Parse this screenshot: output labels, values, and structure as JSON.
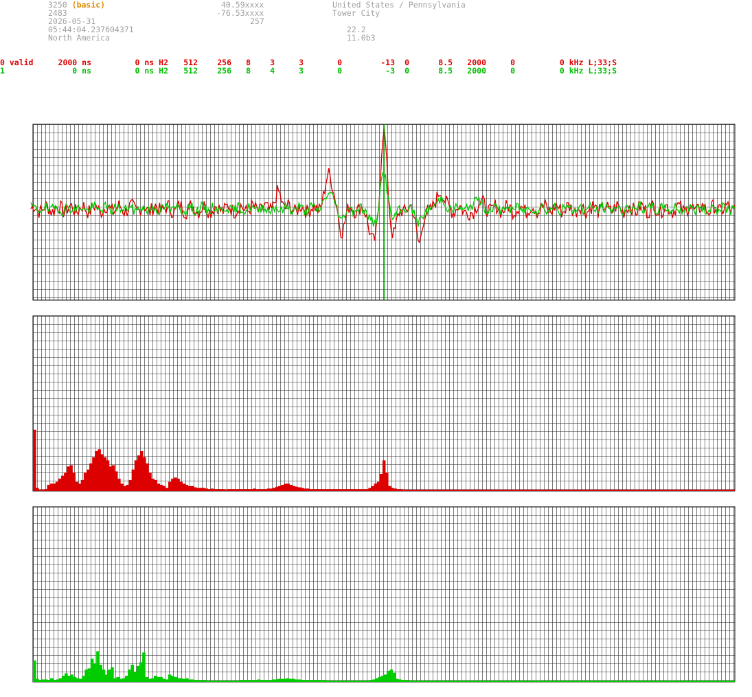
{
  "header": {
    "id": "3250",
    "mode": "(basic)",
    "lat": "40.59xxxx",
    "location": "United States / Pennsylvania",
    "num": "2483",
    "lon": "-76.53xxxx",
    "city": "Tower City",
    "date": "2026-05-31",
    "alt": "257",
    "time": "05:44:04.237604371",
    "v1": "22.2",
    "region": "North America",
    "v2": "11.0b3"
  },
  "rows": [
    {
      "cells": [
        "0 valid",
        "2000 ns",
        "0 ns H2",
        "512",
        "256",
        "8",
        "3",
        "3",
        "0",
        "-13",
        "0",
        "8.5",
        "2000",
        "0",
        "0 kHz L;33;S"
      ]
    },
    {
      "cells": [
        "1",
        "0 ns",
        "0 ns H2",
        "512",
        "256",
        "8",
        "4",
        "3",
        "0",
        "-3",
        "0",
        "8.5",
        "2000",
        "0",
        "0 kHz L;33;S"
      ]
    }
  ],
  "colors": {
    "series_a": "#dd0000",
    "series_b": "#00cc00",
    "grid": "#000000",
    "marker": "#00aa00"
  },
  "chart_data": [
    {
      "type": "line",
      "title": "",
      "grid": true,
      "ylim": [
        -1,
        1
      ],
      "marker_x": 0.5,
      "series": [
        {
          "color": "#dd0000",
          "base_seed": 7,
          "noise": 0.09,
          "features": [
            [
              0.424,
              0.42,
              0.008
            ],
            [
              0.441,
              -0.26,
              0.006
            ],
            [
              0.487,
              -0.42,
              0.008
            ],
            [
              0.501,
              0.95,
              0.006
            ],
            [
              0.515,
              -0.28,
              0.007
            ],
            [
              0.552,
              -0.4,
              0.006
            ],
            [
              0.582,
              0.24,
              0.006
            ],
            [
              0.63,
              -0.18,
              0.008
            ],
            [
              0.634,
              0.22,
              0.007
            ],
            [
              0.352,
              0.18,
              0.006
            ]
          ]
        },
        {
          "color": "#00cc00",
          "base_seed": 19,
          "noise": 0.06,
          "features": [
            [
              0.424,
              0.2,
              0.008
            ],
            [
              0.441,
              -0.12,
              0.006
            ],
            [
              0.487,
              -0.2,
              0.008
            ],
            [
              0.501,
              0.42,
              0.007
            ],
            [
              0.515,
              -0.12,
              0.007
            ],
            [
              0.552,
              -0.18,
              0.006
            ],
            [
              0.582,
              0.14,
              0.006
            ],
            [
              0.634,
              0.12,
              0.007
            ]
          ]
        }
      ]
    },
    {
      "type": "bar",
      "color": "#dd0000",
      "ylim": [
        0,
        100
      ],
      "values": [
        100,
        5,
        2,
        2,
        3,
        10,
        12,
        12,
        15,
        20,
        25,
        30,
        40,
        42,
        30,
        15,
        12,
        18,
        30,
        35,
        45,
        55,
        65,
        68,
        60,
        55,
        50,
        40,
        42,
        32,
        20,
        12,
        8,
        10,
        18,
        35,
        50,
        58,
        65,
        55,
        45,
        30,
        20,
        18,
        12,
        10,
        8,
        5,
        15,
        20,
        22,
        20,
        15,
        12,
        10,
        8,
        8,
        6,
        5,
        5,
        5,
        4,
        3,
        4,
        3,
        3,
        3,
        3,
        2,
        3,
        3,
        3,
        3,
        3,
        3,
        3,
        3,
        3,
        4,
        3,
        3,
        3,
        3,
        4,
        4,
        5,
        7,
        8,
        10,
        12,
        12,
        10,
        8,
        7,
        6,
        5,
        4,
        4,
        3,
        3,
        3,
        3,
        3,
        3,
        3,
        3,
        3,
        3,
        3,
        3,
        3,
        3,
        3,
        3,
        3,
        3,
        3,
        3,
        3,
        5,
        8,
        12,
        15,
        28,
        50,
        30,
        8,
        5,
        4,
        3,
        3,
        2,
        2,
        2,
        2,
        2,
        2,
        2,
        2,
        2,
        2,
        2,
        2,
        2,
        2,
        2,
        2,
        2,
        2,
        2,
        2,
        2,
        2,
        2,
        2,
        2,
        2,
        2,
        2,
        2,
        2,
        2,
        2,
        2,
        2,
        2,
        2,
        2,
        2,
        2,
        2,
        2,
        2,
        2,
        2,
        2,
        2,
        2,
        2,
        2,
        2,
        2,
        2,
        2,
        2,
        2,
        2,
        2,
        2,
        2,
        2,
        2,
        2,
        2,
        2,
        2,
        2,
        2,
        2,
        2,
        2,
        2,
        2,
        2,
        2,
        2,
        2,
        2,
        2,
        2,
        2,
        2,
        2,
        2,
        2,
        2,
        2,
        2,
        2,
        2,
        2,
        2,
        2,
        2,
        2,
        2,
        2,
        2,
        2,
        2,
        2,
        2,
        2,
        2,
        2,
        2,
        2,
        2,
        2,
        2,
        2,
        2,
        2,
        2,
        2,
        2,
        2,
        2,
        2
      ]
    },
    {
      "type": "bar",
      "color": "#00cc00",
      "ylim": [
        0,
        100
      ],
      "values": [
        35,
        5,
        3,
        4,
        4,
        3,
        6,
        3,
        4,
        6,
        10,
        14,
        10,
        12,
        8,
        6,
        5,
        10,
        20,
        22,
        38,
        30,
        50,
        28,
        20,
        12,
        20,
        24,
        6,
        8,
        5,
        6,
        10,
        20,
        28,
        16,
        26,
        32,
        48,
        8,
        5,
        6,
        10,
        8,
        8,
        5,
        4,
        12,
        10,
        8,
        6,
        6,
        5,
        6,
        4,
        4,
        3,
        3,
        3,
        3,
        2,
        2,
        2,
        2,
        2,
        2,
        2,
        2,
        2,
        2,
        2,
        2,
        3,
        3,
        3,
        3,
        3,
        3,
        4,
        3,
        3,
        3,
        3,
        4,
        4,
        5,
        5,
        5,
        6,
        5,
        5,
        4,
        4,
        3,
        3,
        3,
        3,
        3,
        3,
        3,
        3,
        3,
        2,
        2,
        2,
        2,
        2,
        2,
        2,
        2,
        2,
        2,
        2,
        2,
        2,
        2,
        2,
        3,
        4,
        6,
        8,
        10,
        12,
        18,
        20,
        15,
        5,
        4,
        3,
        3,
        3,
        2,
        2,
        2,
        2,
        2,
        2,
        2,
        2,
        2,
        2,
        2,
        2,
        2,
        2,
        2,
        2,
        2,
        2,
        2,
        2,
        2,
        2,
        2,
        2,
        2,
        2,
        2,
        2,
        2,
        2,
        2,
        2,
        2,
        2,
        2,
        2,
        2,
        2,
        2,
        2,
        2,
        2,
        2,
        2,
        2,
        2,
        2,
        2,
        2,
        2,
        2,
        2,
        2,
        2,
        2,
        2,
        2,
        2,
        2,
        2,
        2,
        2,
        2,
        2,
        2,
        2,
        2,
        2,
        2,
        2,
        2,
        2,
        2,
        2,
        2,
        2,
        2,
        2,
        2,
        2,
        2,
        2,
        2,
        2,
        2,
        2,
        2,
        2,
        2,
        2,
        2,
        2,
        2,
        2,
        2,
        2,
        2,
        2,
        2,
        2,
        2,
        2,
        2,
        2,
        2,
        2,
        2,
        2,
        2,
        2,
        2,
        2,
        2
      ]
    }
  ]
}
